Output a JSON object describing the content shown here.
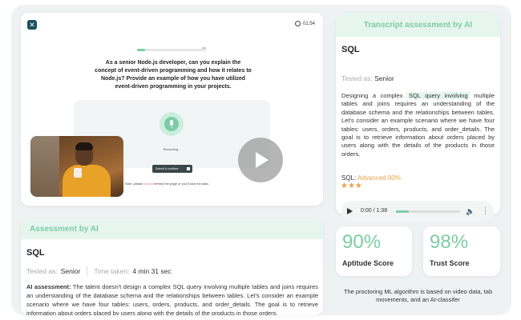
{
  "video": {
    "timer": "01:54",
    "progress_label": "5/11",
    "progress_fraction": 0.12,
    "question": "As a senior Node.js developer, can you explain the concept of event-driven programming and how it relates to Node.js? Provide an example of how you have utilized event-driven programming in your projects.",
    "recording_label": "Recording...",
    "submit_label": "Submit & continue",
    "note_prefix": "Note: please ",
    "note_highlight": "do not",
    "note_suffix": " refresh the page or you'll lose the data."
  },
  "transcript": {
    "header": "Transcript assessment by AI",
    "topic": "SQL",
    "tested_as_label": "Tested as:",
    "tested_as_value": "Senior",
    "text_prefix": "Designing a complex ",
    "text_highlight": "SQL query involving",
    "text_suffix": " multiple tables and joins requires an understanding of the database schema and the relationships between tables. Let's consider an example scenario where we have four tables: users, orders, products, and order_details. The goal is to retrieve information about orders placed by users along with the details of the products in those orders.",
    "rating_prefix": "SQL:",
    "rating_level": "Advanced 80%",
    "stars": "★★★",
    "audio_time": "0:00 / 1:38",
    "audio_progress_fraction": 0.2,
    "icons": {
      "play": "play-icon",
      "volume": "volume-icon",
      "more": "more-vertical-icon"
    }
  },
  "assessment": {
    "header": "Assessment by AI",
    "topic": "SQL",
    "tested_as_label": "Tested as:",
    "tested_as_value": "Senior",
    "time_label": "Time taken:",
    "time_value": "4 min 31 sec",
    "text_label": "AI assessment:",
    "text": " The talent doesn't design a complex SQL query involving multiple tables and joins requires an understanding of the database schema and the relationships between tables. Let's consider an example scenario where we have four tables: users, orders, products, and order_details. The goal is to retrieve information about orders placed by users along with the details of the products in those orders."
  },
  "scores": {
    "aptitude_value": "90%",
    "aptitude_label": "Aptitude Score",
    "trust_value": "98%",
    "trust_label": "Trust Score"
  },
  "footer_note": "The proctoring ML algorithm is based on video data, tab movements, and an AI-classifer",
  "colors": {
    "accent": "#7ccca6",
    "rating": "#e8a248",
    "header_bg": "#e6f5ee"
  }
}
